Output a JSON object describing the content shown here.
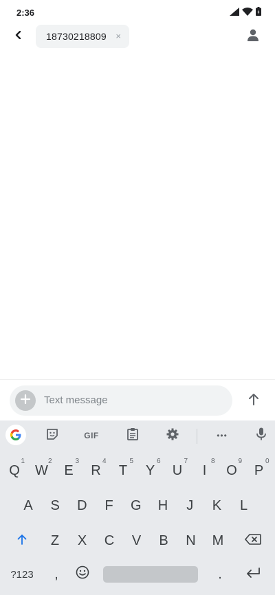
{
  "status_bar": {
    "time": "2:36",
    "icons": [
      "signal-icon",
      "wifi-icon",
      "battery-icon"
    ]
  },
  "app_bar": {
    "back_icon": "back-arrow-icon",
    "recipient": "18730218809",
    "chip_close": "×",
    "contact_icon": "person-icon"
  },
  "compose": {
    "placeholder": "Text message",
    "add_icon": "plus-icon",
    "send_icon": "send-arrow-icon"
  },
  "keyboard": {
    "toolbar": [
      "google-icon",
      "sticker-icon",
      "gif",
      "clipboard-icon",
      "gear-icon",
      "more-icon",
      "mic-icon"
    ],
    "gif_label": "GIF",
    "more_label": "•••",
    "row1": [
      {
        "k": "Q",
        "h": "1"
      },
      {
        "k": "W",
        "h": "2"
      },
      {
        "k": "E",
        "h": "3"
      },
      {
        "k": "R",
        "h": "4"
      },
      {
        "k": "T",
        "h": "5"
      },
      {
        "k": "Y",
        "h": "6"
      },
      {
        "k": "U",
        "h": "7"
      },
      {
        "k": "I",
        "h": "8"
      },
      {
        "k": "O",
        "h": "9"
      },
      {
        "k": "P",
        "h": "0"
      }
    ],
    "row2": [
      "A",
      "S",
      "D",
      "F",
      "G",
      "H",
      "J",
      "K",
      "L"
    ],
    "row3": [
      "Z",
      "X",
      "C",
      "V",
      "B",
      "N",
      "M"
    ],
    "bottom": {
      "symbols": "?123",
      "comma": ",",
      "period": "."
    },
    "accent_color": "#1a73e8"
  }
}
